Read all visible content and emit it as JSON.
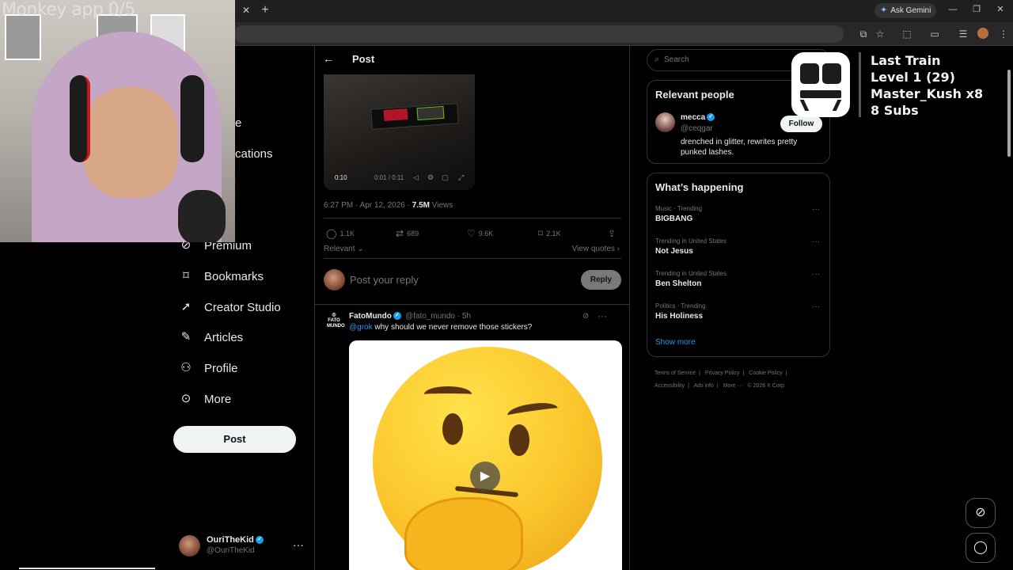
{
  "browser": {
    "ask_gemini": "Ask Gemini",
    "new_tab": "+",
    "close_tab": "✕"
  },
  "webcam": {
    "caption": "Monkey app 0/5"
  },
  "sidebar": {
    "partial_items": [
      {
        "label": "e",
        "icon": "home-icon"
      },
      {
        "label": "cations",
        "icon": "bell-icon"
      }
    ],
    "items": [
      {
        "label": "Premium",
        "icon": "premium-icon"
      },
      {
        "label": "Bookmarks",
        "icon": "bookmark-icon"
      },
      {
        "label": "Creator Studio",
        "icon": "rocket-icon"
      },
      {
        "label": "Articles",
        "icon": "articles-icon"
      },
      {
        "label": "Profile",
        "icon": "profile-icon"
      },
      {
        "label": "More",
        "icon": "more-circle-icon"
      }
    ],
    "post_button": "Post",
    "account": {
      "name": "OuriTheKid",
      "handle": "@OuriTheKid"
    }
  },
  "post": {
    "header_title": "Post",
    "video": {
      "current_time": "0:10",
      "progress": "0:01 / 0:11"
    },
    "meta": {
      "time": "6:27 PM · Apr 12, 2026 · ",
      "views_count": "7.5M",
      "views_label": " Views"
    },
    "actions": {
      "replies": "1.1K",
      "reposts": "689",
      "likes": "9.6K",
      "bookmarks": "2.1K"
    },
    "relevant": "Relevant",
    "view_quotes": "View quotes",
    "reply_placeholder": "Post your reply",
    "reply_button": "Reply"
  },
  "reply_tweet": {
    "logo_text": "FATO MUNDO",
    "name": "FatoMundo",
    "handle_time": "@fato_mundo · 5h",
    "mention": "@grok",
    "text": " why should we never remove those stickers?"
  },
  "right": {
    "search_placeholder": "Search",
    "relevant_people": {
      "title": "Relevant people",
      "name": "mecca",
      "handle": "@ceqgar",
      "bio": "drenched in glitter, rewrites pretty punked lashes.",
      "follow": "Follow"
    },
    "happening": {
      "title": "What’s happening",
      "trends": [
        {
          "context": "Music · Trending",
          "topic": "BIGBANG"
        },
        {
          "context": "Trending in United States",
          "topic": "Not Jesus"
        },
        {
          "context": "Trending in United States",
          "topic": "Ben Shelton"
        },
        {
          "context": "Politics · Trending",
          "topic": "His Holiness"
        }
      ],
      "show_more": "Show more"
    },
    "footer": [
      "Terms of Service",
      "|",
      "Privacy Policy",
      "|",
      "Cookie Policy",
      "|",
      "Accessibility",
      "|",
      "Ads info",
      "|",
      "More ···",
      "© 2026 X Corp."
    ]
  },
  "overlay": {
    "line1": "Last Train",
    "line2": "Level 1  (29)",
    "line3": "Master_Kush x8",
    "line4": "8 Subs"
  }
}
